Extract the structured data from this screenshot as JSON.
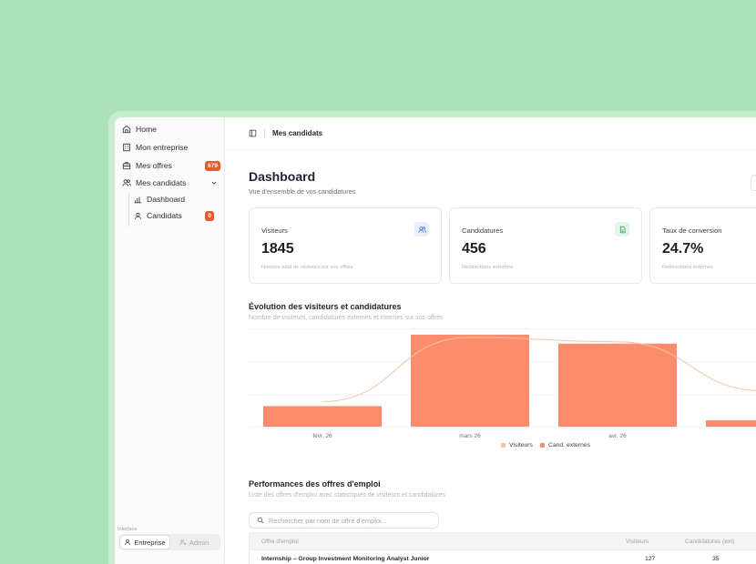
{
  "sidebar": {
    "items": [
      {
        "label": "Home",
        "icon": "home-icon"
      },
      {
        "label": "Mon entreprise",
        "icon": "building-icon"
      },
      {
        "label": "Mes offres",
        "icon": "briefcase-icon",
        "badge": "679"
      },
      {
        "label": "Mes candidats",
        "icon": "users-icon"
      }
    ],
    "sub_items": [
      {
        "label": "Dashboard",
        "icon": "bar-chart-icon"
      },
      {
        "label": "Candidats",
        "icon": "user-icon",
        "badge": "0"
      }
    ],
    "interface_label": "Interface",
    "switcher": {
      "entreprise": "Entreprise",
      "admin": "Admin"
    }
  },
  "topbar": {
    "title": "Mes candidats"
  },
  "header": {
    "title": "Dashboard",
    "subtitle": "Vue d'ensemble de vos candidatures"
  },
  "cards": [
    {
      "label": "Visiteurs",
      "value": "1845",
      "desc": "Nombre total de visiteurs sur vos offres",
      "icon": "users-icon",
      "icon_color": "#4a7bd8",
      "icon_bg": "#e8effb"
    },
    {
      "label": "Candidatures",
      "value": "456",
      "desc": "Redirections externes",
      "icon": "file-icon",
      "icon_color": "#2f9e55",
      "icon_bg": "#e4f5e9"
    },
    {
      "label": "Taux de conversion",
      "value": "24.7%",
      "desc": "Redirections externes",
      "icon": "",
      "icon_color": "",
      "icon_bg": ""
    }
  ],
  "evolution": {
    "title": "Évolution des visiteurs et candidatures",
    "subtitle": "Nombre de visiteurs, candidatures externes et internes sur vos offres"
  },
  "chart_data": {
    "type": "bar",
    "categories": [
      "févr. 26",
      "mars 26",
      "avr. 26",
      ""
    ],
    "series": [
      {
        "name": "Visiteurs",
        "values": [
          28,
          100,
          95,
          40
        ],
        "color": "#f7c3a8",
        "render": "line"
      },
      {
        "name": "Cand. externes",
        "values": [
          23,
          103,
          93,
          7
        ],
        "color": "#fd8c6c",
        "render": "bar"
      }
    ],
    "ylim": [
      0,
      110
    ],
    "grid": true,
    "legend": "bottom-center"
  },
  "performances": {
    "title": "Performances des offres d'emploi",
    "subtitle": "Liste des offres d'emploi avec statistiques de visiteurs et candidatures",
    "search_placeholder": "Rechercher par nom de offre d'emploi...",
    "columns": [
      "Offre d'emploi",
      "Visiteurs",
      "Candidatures (ext)"
    ],
    "rows": [
      {
        "offre": "Internship – Group Investment Monitoring Analyst Junior",
        "visiteurs": "127",
        "candidatures": "35"
      }
    ]
  }
}
